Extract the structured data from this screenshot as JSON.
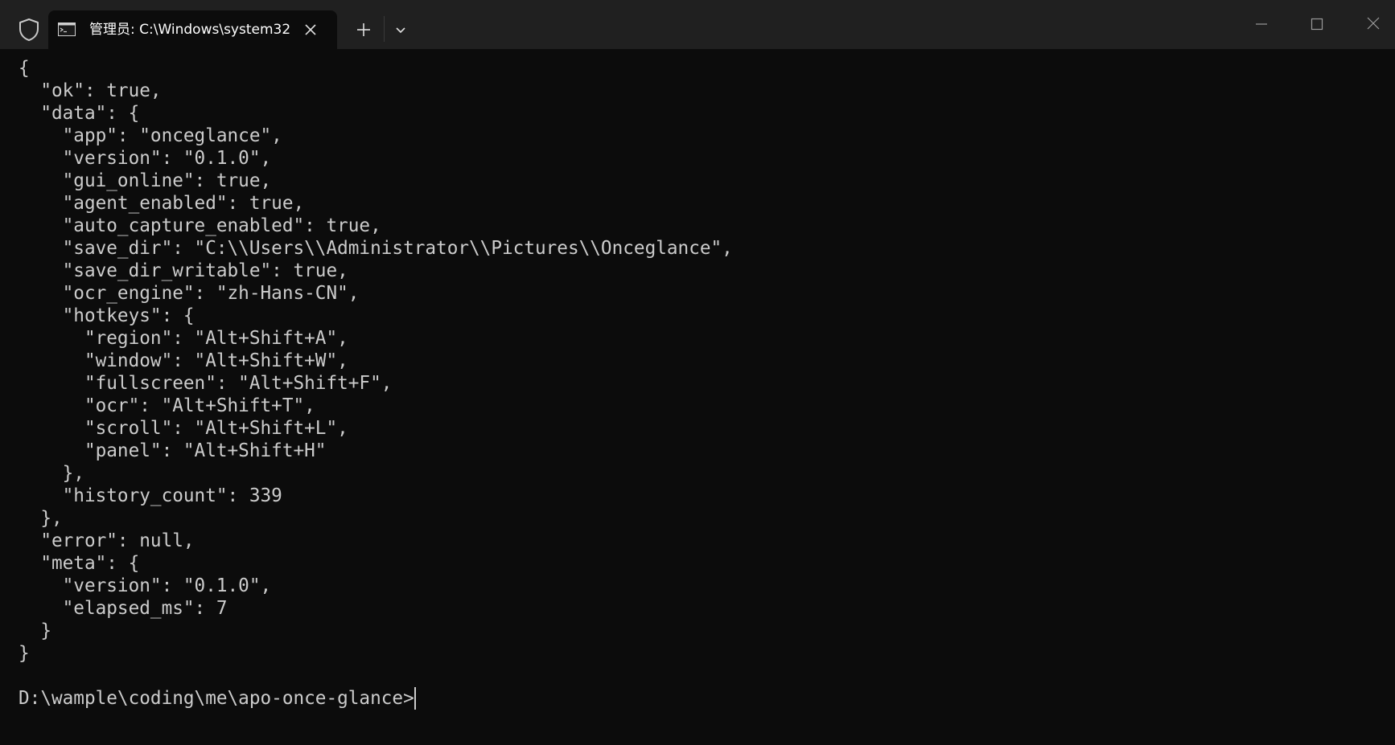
{
  "titlebar": {
    "tab_title": "管理员: C:\\Windows\\system32",
    "icons": {
      "shield": "shield-icon",
      "terminal": "terminal-icon",
      "close_tab": "close-icon",
      "new_tab": "plus-icon",
      "dropdown": "chevron-down-icon",
      "minimize": "minimize-icon",
      "maximize": "maximize-icon",
      "close_window": "close-icon"
    }
  },
  "terminal": {
    "output": "{\n  \"ok\": true,\n  \"data\": {\n    \"app\": \"onceglance\",\n    \"version\": \"0.1.0\",\n    \"gui_online\": true,\n    \"agent_enabled\": true,\n    \"auto_capture_enabled\": true,\n    \"save_dir\": \"C:\\\\Users\\\\Administrator\\\\Pictures\\\\Onceglance\",\n    \"save_dir_writable\": true,\n    \"ocr_engine\": \"zh-Hans-CN\",\n    \"hotkeys\": {\n      \"region\": \"Alt+Shift+A\",\n      \"window\": \"Alt+Shift+W\",\n      \"fullscreen\": \"Alt+Shift+F\",\n      \"ocr\": \"Alt+Shift+T\",\n      \"scroll\": \"Alt+Shift+L\",\n      \"panel\": \"Alt+Shift+H\"\n    },\n    \"history_count\": 339\n  },\n  \"error\": null,\n  \"meta\": {\n    \"version\": \"0.1.0\",\n    \"elapsed_ms\": 7\n  }\n}",
    "prompt": "D:\\wample\\coding\\me\\apo-once-glance>"
  },
  "colors": {
    "background": "#0c0c0c",
    "titlebar": "#202020",
    "text": "#cccccc"
  }
}
